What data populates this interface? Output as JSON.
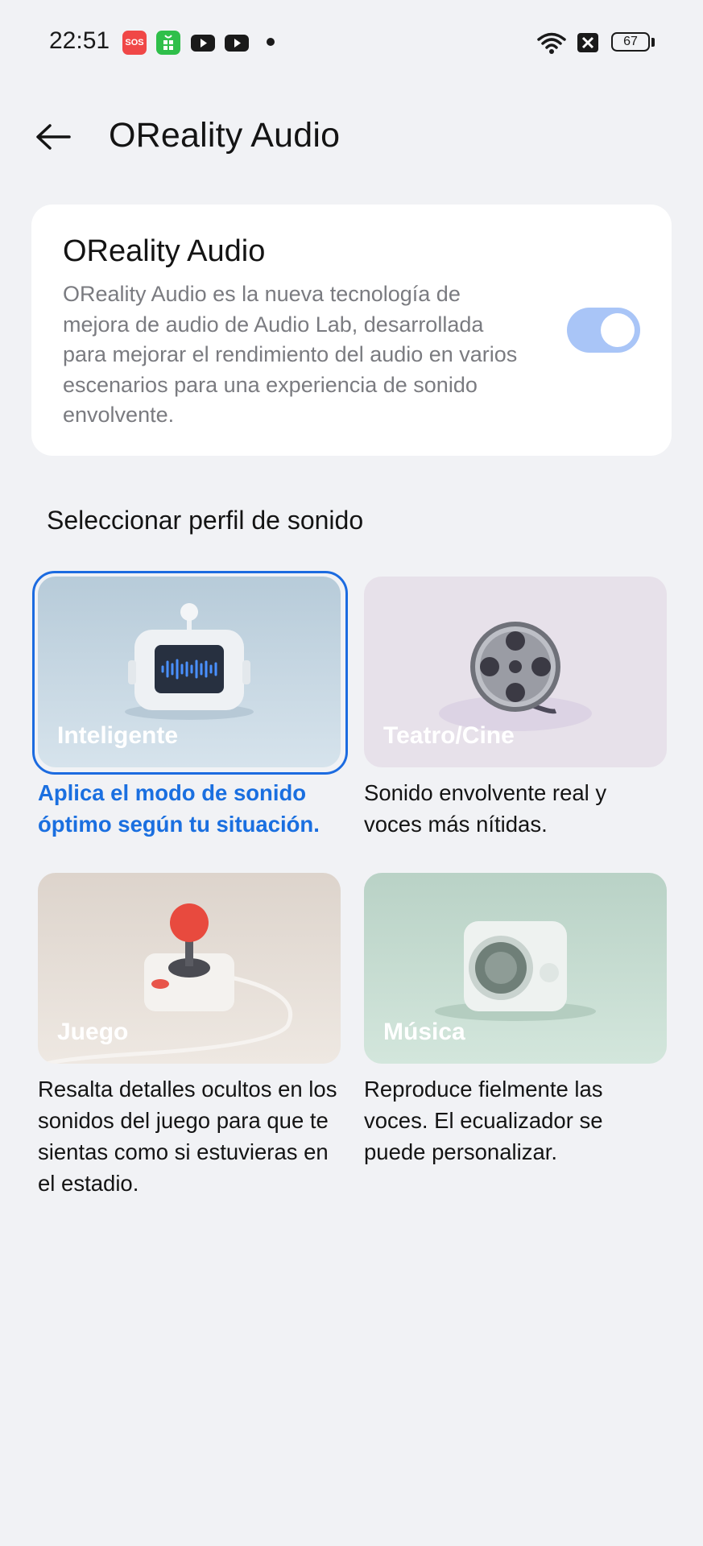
{
  "status_bar": {
    "time": "22:51",
    "sos_label": "SOS",
    "battery": "67"
  },
  "header": {
    "title": "OReality Audio"
  },
  "oreality_card": {
    "title": "OReality Audio",
    "description": "OReality Audio es la nueva tecnología de mejora de audio de Audio Lab, desarrollada para mejorar el rendimiento del audio en varios escenarios para una experiencia de sonido envolvente.",
    "enabled": true
  },
  "section_title": "Seleccionar perfil de sonido",
  "profiles": [
    {
      "label": "Inteligente",
      "description": "Aplica el modo de sonido óptimo según tu situación.",
      "selected": true
    },
    {
      "label": "Teatro/Cine",
      "description": "Sonido envolvente real y voces más nítidas.",
      "selected": false
    },
    {
      "label": "Juego",
      "description": "Resalta detalles ocultos en los sonidos del juego para que te sientas como si estuvieras en el estadio.",
      "selected": false
    },
    {
      "label": "Música",
      "description": "Reproduce fielmente las voces. El ecualizador se puede personalizar.",
      "selected": false
    }
  ],
  "colors": {
    "accent": "#1c6be0",
    "toggle_on": "#a9c5f7",
    "background": "#f1f2f5"
  }
}
